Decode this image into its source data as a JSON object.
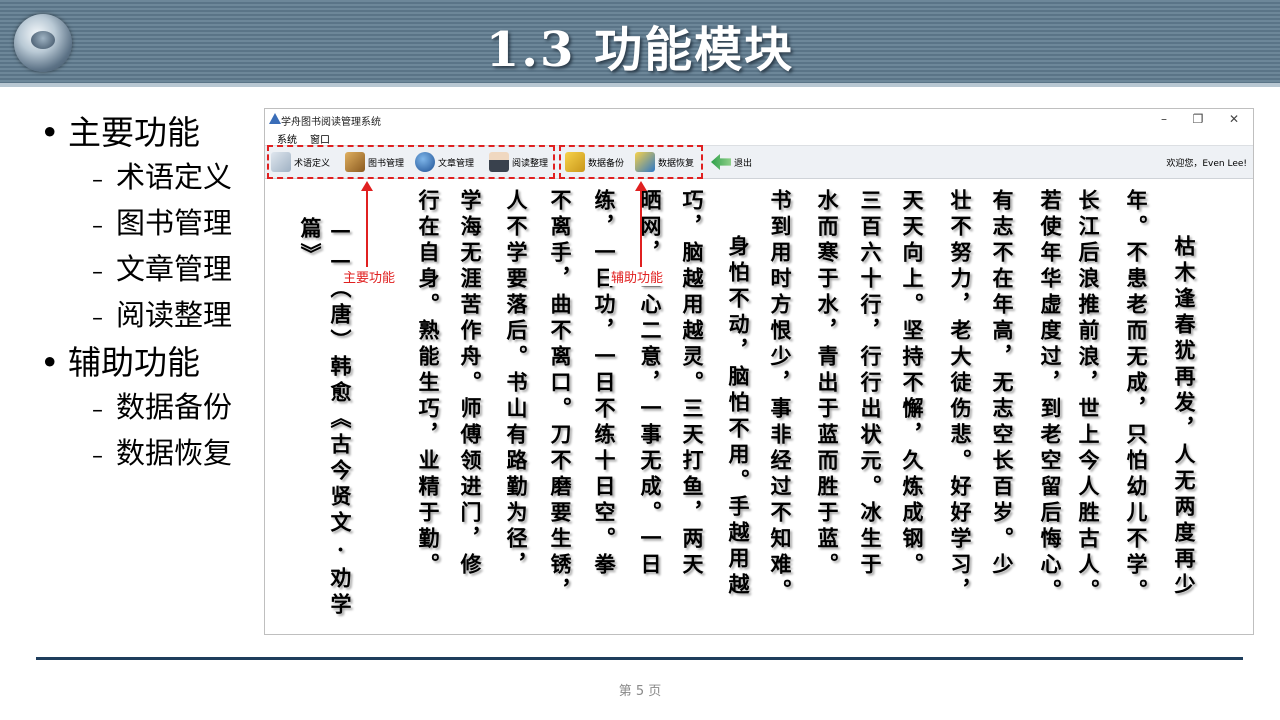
{
  "slide": {
    "title": "1.3  功能模块",
    "page_label": "第 5 页"
  },
  "bullets": [
    {
      "text": "主要功能",
      "children": [
        "术语定义",
        "图书管理",
        "文章管理",
        "阅读整理"
      ]
    },
    {
      "text": "辅助功能",
      "children": [
        "数据备份",
        "数据恢复"
      ]
    }
  ],
  "window": {
    "title": "学舟图书阅读管理系统",
    "controls": {
      "minimize": "–",
      "restore": "❐",
      "close": "✕"
    },
    "menu": [
      "系统",
      "窗口"
    ],
    "toolbar": {
      "main_group": [
        "术语定义",
        "图书管理",
        "文章管理",
        "阅读整理"
      ],
      "aux_group": [
        "数据备份",
        "数据恢复"
      ],
      "exit": "退出",
      "welcome": "欢迎您，Even Lee!"
    }
  },
  "annotations": {
    "main": "主要功能",
    "aux": "辅助功能",
    "color": "#e02020"
  },
  "icons": [
    "term-icon",
    "book-icon",
    "globe-icon",
    "reader-icon",
    "backup-icon",
    "restore-icon",
    "exit-icon"
  ],
  "poem_columns": [
    "枯木逢春犹再发，人无两度再少",
    "年。不患老而无成，只怕幼儿不学。",
    "长江后浪推前浪，世上今人胜古人。",
    "若使年华虚度过，到老空留后悔心。",
    "有志不在年高，无志空长百岁。少",
    "壮不努力，老大徒伤悲。好好学习，",
    "天天向上。坚持不懈，久炼成钢。",
    "三百六十行，行行出状元。冰生于",
    "水而寒于水，青出于蓝而胜于蓝。",
    "书到用时方恨少，事非经过不知难。",
    "身怕不动，脑怕不用。手越用越",
    "巧，脑越用越灵。三天打鱼，两天",
    "晒网，三心二意，一事无成。一日",
    "练，一日功，一日不练十日空。拳",
    "不离手，曲不离口。刀不磨要生锈，",
    "人不学要落后。书山有路勤为径，",
    "学海无涯苦作舟。师傅领进门，修",
    "行在自身。熟能生巧，业精于勤。",
    "——（唐）韩愈《古今贤文·劝学篇》"
  ]
}
